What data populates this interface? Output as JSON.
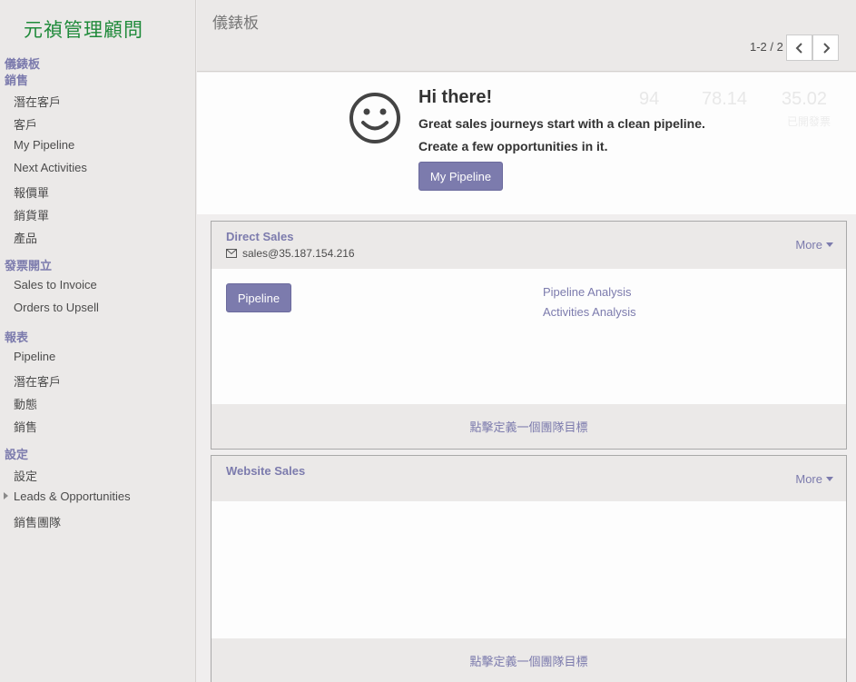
{
  "brand": {
    "logo_text": "元禎管理顧問"
  },
  "sidebar": {
    "sections": [
      {
        "title": "儀錶板"
      },
      {
        "title": "銷售",
        "items": [
          "潛在客戶",
          "客戶",
          "My Pipeline",
          "Next Activities",
          "報價單",
          "銷貨單",
          "產品"
        ]
      },
      {
        "title": "發票開立",
        "items": [
          "Sales to Invoice",
          "Orders to Upsell"
        ]
      },
      {
        "title": "報表",
        "items": [
          "Pipeline",
          "潛在客戶",
          "動態",
          "銷售"
        ]
      },
      {
        "title": "設定",
        "items": [
          "設定",
          "Leads & Opportunities",
          "銷售團隊"
        ]
      }
    ]
  },
  "control": {
    "breadcrumb": "儀錶板",
    "pager": "1-2 / 2"
  },
  "hello": {
    "title": "Hi there!",
    "line1": "Great sales journeys start with a clean pipeline.",
    "line2": "Create a few opportunities in it.",
    "button": "My Pipeline",
    "ghost": {
      "v1": "94",
      "v2": "78.14",
      "v3": "35.02",
      "label3": "已開發票"
    }
  },
  "teams": [
    {
      "name": "Direct Sales",
      "alias": "sales@35.187.154.216",
      "more": "More",
      "pipeline_button": "Pipeline",
      "links": [
        "Pipeline Analysis",
        "Activities Analysis"
      ],
      "footer": "點擊定義一個團隊目標"
    },
    {
      "name": "Website Sales",
      "more": "More",
      "footer": "點擊定義一個團隊目標"
    }
  ],
  "colors": {
    "accent": "#7c7bad",
    "logo": "#1f8a3a"
  },
  "icons": [
    "smiley-icon",
    "envelope-icon",
    "chevron-left-icon",
    "chevron-right-icon",
    "caret-down-icon",
    "caret-right-icon"
  ]
}
